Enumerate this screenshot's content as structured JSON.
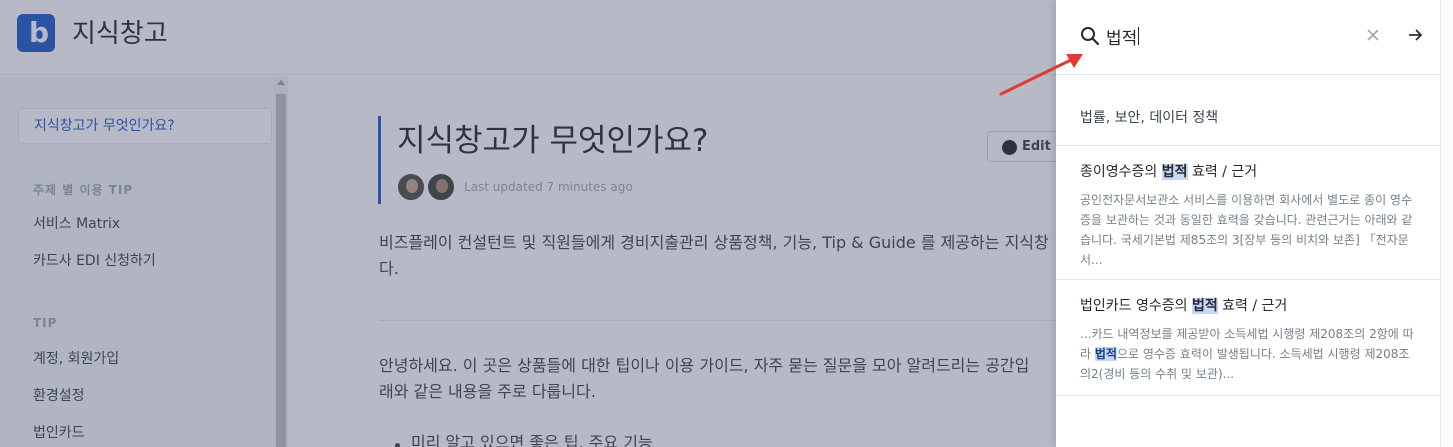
{
  "header": {
    "logo_letter": "b",
    "site_title": "지식창고"
  },
  "sidebar": {
    "active_item": "지식창고가 무엇인가요?",
    "sections": [
      {
        "heading": "주제 별 이용 TIP",
        "items": [
          "서비스 Matrix",
          "카드사 EDI 신청하기"
        ]
      },
      {
        "heading": "TIP",
        "items": [
          "계정, 회원가입",
          "환경설정",
          "법인카드"
        ]
      }
    ]
  },
  "page": {
    "title": "지식창고가 무엇인가요?",
    "last_updated": "Last updated 7 minutes ago",
    "edit_label": "Edit o",
    "intro_line1": "비즈플레이 컨설턴트 및 직원들에게 경비지출관리 상품정책, 기능, Tip & Guide 를 제공하는 지식창",
    "intro_line2": "다.",
    "body_line1": "안녕하세요. 이 곳은 상품들에 대한 팁이나 이용 가이드, 자주 묻는 질문을 모아 알려드리는 공간입",
    "body_line2": "래와 같은 내용을 주로 다룹니다.",
    "bullet1": "미리 알고 있으면 좋은 팁, 주요 기능"
  },
  "search": {
    "query": "법적",
    "category": "법률, 보안, 데이터 정책",
    "results": [
      {
        "title_pre": "종이영수증의 ",
        "title_hl": "법적",
        "title_post": " 효력 / 근거",
        "snippet": "공인전자문서보관소 서비스를 이용하면 회사에서 별도로 종이 영수증을 보관하는 것과 동일한 효력을 갖습니다. 관련근거는 아래와 같습니다. 국세기본법 제85조의 3[장부 등의 비치와 보존] 「전자문서..."
      },
      {
        "title_pre": "법인카드 영수증의 ",
        "title_hl": "법적",
        "title_post": " 효력 / 근거",
        "snippet_pre": "...카드 내역정보를 제공받아 소득세법 시행령 제208조의 2항에 따라 ",
        "snippet_hl": "법적",
        "snippet_post": "으로 영수증 효력이 발생됩니다. 소득세법 시행령 제208조의2(경비 등의 수취 및 보관)..."
      }
    ]
  },
  "colors": {
    "accent": "#1f5ec9",
    "highlight": "#c6d8f5",
    "annotation_arrow": "#e03a31"
  }
}
